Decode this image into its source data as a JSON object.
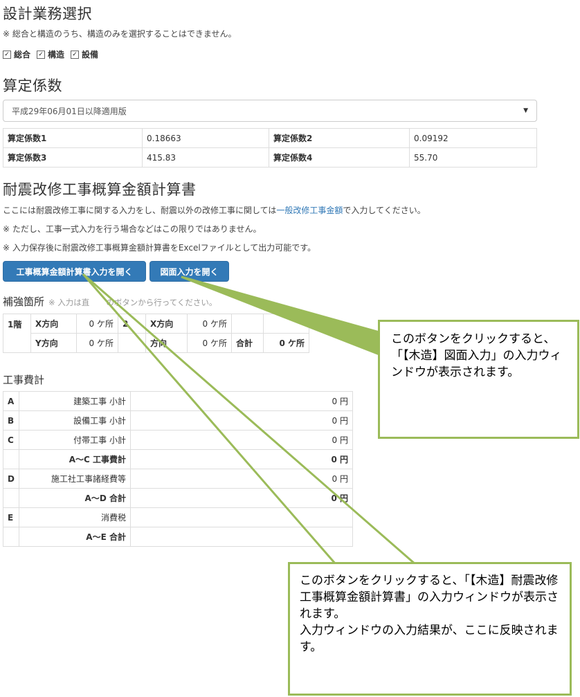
{
  "sections": {
    "business_select": {
      "title": "設計業務選択",
      "note": "※ 総合と構造のうち、構造のみを選択することはできません。",
      "checkboxes": [
        {
          "label": "総合",
          "checked": true
        },
        {
          "label": "構造",
          "checked": true
        },
        {
          "label": "設備",
          "checked": true
        }
      ]
    },
    "coefficients": {
      "title": "算定係数",
      "select_value": "平成29年06月01日以降適用版",
      "rows": [
        [
          {
            "label": "算定係数1",
            "value": "0.18663"
          },
          {
            "label": "算定係数2",
            "value": "0.09192"
          }
        ],
        [
          {
            "label": "算定係数3",
            "value": "415.83"
          },
          {
            "label": "算定係数4",
            "value": "55.70"
          }
        ]
      ]
    },
    "calc": {
      "title": "耐震改修工事概算金額計算書",
      "note1_pre": "ここには耐震改修工事に関する入力をし、耐震以外の改修工事に関しては",
      "note1_link": "一般改修工事金額",
      "note1_post": "で入力してください。",
      "note2": "※ ただし、工事一式入力を行う場合などはこの限りではありません。",
      "note3": "※ 入力保存後に耐震改修工事概算金額計算書をExcelファイルとして出力可能です。",
      "btn_open_calc": "工事概算金額計算書入力を開く",
      "btn_open_drawing": "図面入力を開く"
    },
    "reinforce": {
      "title": "補強箇所",
      "note": "※ 入力は直",
      "note_tail": "のボタンから行ってください。",
      "floor": "1階",
      "rows": [
        {
          "dir1": "X方向",
          "val1": "0 ケ所",
          "mid": "2",
          "dir2": "X方向",
          "val2": "0 ケ所",
          "sumlabel": "",
          "sumval": ""
        },
        {
          "dir1": "Y方向",
          "val1": "0 ケ所",
          "mid": "",
          "dir2": "方向",
          "val2": "0 ケ所",
          "sumlabel": "合計",
          "sumval": "0 ケ所"
        }
      ]
    },
    "costs": {
      "title": "工事費計",
      "rows": [
        {
          "key": "A",
          "name": "建築工事 小計",
          "value": "0 円",
          "bold": false
        },
        {
          "key": "B",
          "name": "設備工事 小計",
          "value": "0 円",
          "bold": false
        },
        {
          "key": "C",
          "name": "付帯工事 小計",
          "value": "0 円",
          "bold": false
        },
        {
          "key": "",
          "name": "A～C 工事費計",
          "value": "0 円",
          "bold": true
        },
        {
          "key": "D",
          "name": "施工社工事諸経費等",
          "value": "0 円",
          "bold": false
        },
        {
          "key": "",
          "name": "A～D 合計",
          "value": "0 円",
          "bold": true
        },
        {
          "key": "E",
          "name": "消費税",
          "value": "",
          "bold": false
        },
        {
          "key": "",
          "name": "A～E 合計",
          "value": "",
          "bold": true
        }
      ]
    }
  },
  "callouts": {
    "drawing": "このボタンをクリックすると、「【木造】図面入力」の入力ウィンドウが表示されます。",
    "calc": "このボタンをクリックすると、「【木造】耐震改修工事概算金額計算書」の入力ウィンドウが表示されます。\n入力ウィンドウの入力結果が、ここに反映されます。"
  },
  "colors": {
    "accent": "#337ab7",
    "callout_border": "#9bbb59"
  }
}
